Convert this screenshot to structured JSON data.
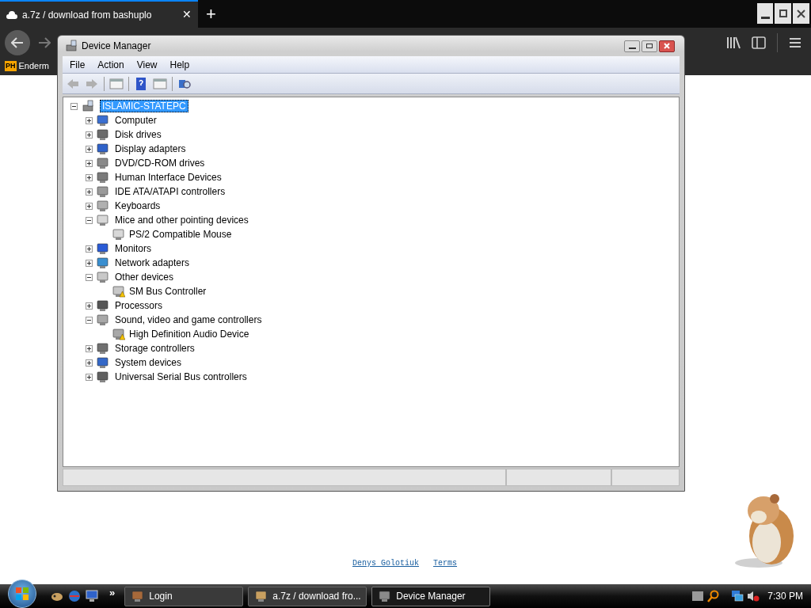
{
  "browser": {
    "tabs": [
      {
        "label": "a.7z / download from bashuplo",
        "close": "✕",
        "selected": true
      }
    ],
    "new_tab": "+",
    "bookmarks": [
      {
        "badge": "PH",
        "label": "Enderm"
      }
    ]
  },
  "window": {
    "title": "Device Manager",
    "menu": [
      "File",
      "Action",
      "View",
      "Help"
    ],
    "tree": {
      "label": "ISLAMIC-STATEPC",
      "expanded": true,
      "selected": true,
      "children": [
        {
          "label": "Computer",
          "expanded": false
        },
        {
          "label": "Disk drives",
          "expanded": false
        },
        {
          "label": "Display adapters",
          "expanded": false
        },
        {
          "label": "DVD/CD-ROM drives",
          "expanded": false
        },
        {
          "label": "Human Interface Devices",
          "expanded": false
        },
        {
          "label": "IDE ATA/ATAPI controllers",
          "expanded": false
        },
        {
          "label": "Keyboards",
          "expanded": false
        },
        {
          "label": "Mice and other pointing devices",
          "expanded": true,
          "children": [
            {
              "label": "PS/2 Compatible Mouse",
              "warning": false
            }
          ]
        },
        {
          "label": "Monitors",
          "expanded": false
        },
        {
          "label": "Network adapters",
          "expanded": false
        },
        {
          "label": "Other devices",
          "expanded": true,
          "children": [
            {
              "label": "SM Bus Controller",
              "warning": true
            }
          ]
        },
        {
          "label": "Processors",
          "expanded": false
        },
        {
          "label": "Sound, video and game controllers",
          "expanded": true,
          "children": [
            {
              "label": "High Definition Audio Device",
              "warning": true
            }
          ]
        },
        {
          "label": "Storage controllers",
          "expanded": false
        },
        {
          "label": "System devices",
          "expanded": false
        },
        {
          "label": "Universal Serial Bus controllers",
          "expanded": false
        }
      ]
    }
  },
  "footer_links": [
    "Denys Golotiuk",
    "Terms"
  ],
  "taskbar": {
    "overflow": "»",
    "buttons": [
      {
        "label": "Login",
        "selected": false
      },
      {
        "label": "a.7z / download fro...",
        "selected": false
      },
      {
        "label": "Device Manager",
        "selected": true
      }
    ],
    "clock": "7:30 PM"
  }
}
